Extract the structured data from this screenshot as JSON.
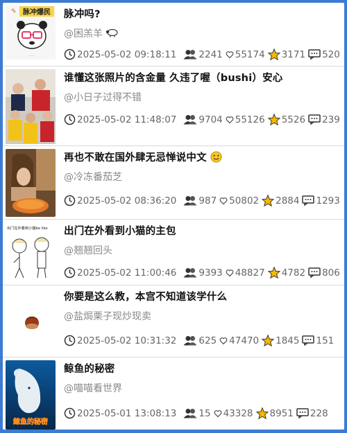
{
  "posts": [
    {
      "title": "脉冲吗?",
      "author": "@困羔羊",
      "thumb_text": "脉冲爆民",
      "timestamp": "2025-05-02 09:18:11",
      "views": "2241",
      "likes": "55174",
      "favorites": "3171",
      "comments": "520"
    },
    {
      "title": "谁懂这张照片的含金量 久违了喔（bushi）安心",
      "author": "@小日子过得不错",
      "timestamp": "2025-05-02 11:48:07",
      "views": "9704",
      "likes": "55126",
      "favorites": "5526",
      "comments": "239"
    },
    {
      "title": "再也不敢在国外肆无忌惮说中文",
      "author": "@冷冻番茄芝",
      "timestamp": "2025-05-02 08:36:20",
      "views": "987",
      "likes": "50802",
      "favorites": "2884",
      "comments": "1293"
    },
    {
      "title": "出门在外看到小猫的主包",
      "author": "@翘翘回头",
      "thumb_text": "出门在外看到小猫be like",
      "timestamp": "2025-05-02 11:00:46",
      "views": "9393",
      "likes": "48827",
      "favorites": "4782",
      "comments": "806"
    },
    {
      "title": "你要是这么教，本宫不知道该学什么",
      "author": "@盐焗栗子现炒现卖",
      "timestamp": "2025-05-02 10:31:32",
      "views": "625",
      "likes": "47470",
      "favorites": "1845",
      "comments": "151"
    },
    {
      "title": "鲸鱼的秘密",
      "author": "@喵喵看世界",
      "thumb_text": "鲸鱼的秘密",
      "timestamp": "2025-05-01 13:08:13",
      "views": "15",
      "likes": "43328",
      "favorites": "8951",
      "comments": "228"
    }
  ],
  "icons": {
    "time": "clock-icon",
    "views": "people-icon",
    "likes": "heart-icon",
    "favorites": "star-icon",
    "comments": "comment-icon"
  },
  "colors": {
    "background": "#3d7bd3",
    "star": "#f5b800",
    "text_muted": "#888888"
  }
}
